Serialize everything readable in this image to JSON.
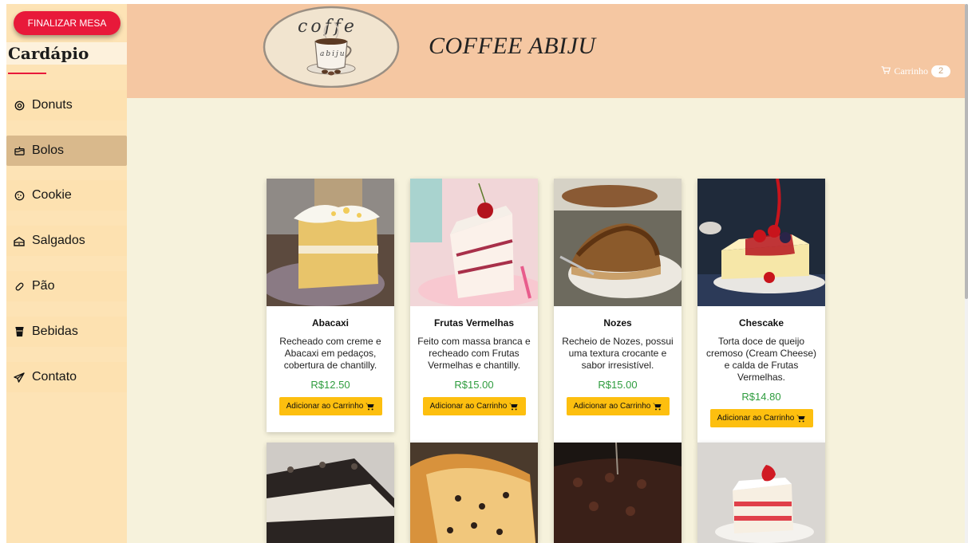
{
  "sidebar": {
    "finalize_label": "FINALIZAR MESA",
    "menu_title": "Cardápio",
    "items": [
      {
        "label": "Donuts",
        "icon": "target-icon"
      },
      {
        "label": "Bolos",
        "icon": "cake-icon"
      },
      {
        "label": "Cookie",
        "icon": "cookie-icon"
      },
      {
        "label": "Salgados",
        "icon": "salgados-icon"
      },
      {
        "label": "Pão",
        "icon": "bread-icon"
      },
      {
        "label": "Bebidas",
        "icon": "cup-icon"
      },
      {
        "label": "Contato",
        "icon": "send-icon"
      }
    ],
    "active_item": "Bolos"
  },
  "header": {
    "logo_text_top": "coffe",
    "logo_text_cup": "abiju",
    "brand": "COFFEE ABIJU",
    "cart_label": "Carrinho",
    "cart_count": "2"
  },
  "products": [
    {
      "title": "Abacaxi",
      "desc": "Recheado com creme e Abacaxi em pedaços, cobertura de chantilly.",
      "price": "R$12.50",
      "button": "Adicionar ao Carrinho"
    },
    {
      "title": "Frutas Vermelhas",
      "desc": "Feito com massa branca e recheado com Frutas Vermelhas e chantilly.",
      "price": "R$15.00",
      "button": "Adicionar ao Carrinho"
    },
    {
      "title": "Nozes",
      "desc": "Recheio de Nozes, possui uma textura crocante e sabor irresistível.",
      "price": "R$15.00",
      "button": "Adicionar ao Carrinho"
    },
    {
      "title": "Chescake",
      "desc": "Torta doce de queijo cremoso (Cream Cheese) e calda de Frutas Vermelhas.",
      "price": "R$14.80",
      "button": "Adicionar ao Carrinho"
    }
  ],
  "colors": {
    "accent_red": "#e8193a",
    "header_bg": "#f5c7a2",
    "sidebar_bg": "#fde3b5",
    "main_bg": "#f6f2dc",
    "button_yellow": "#fdbf0f",
    "price_green": "#2e9c3e"
  }
}
